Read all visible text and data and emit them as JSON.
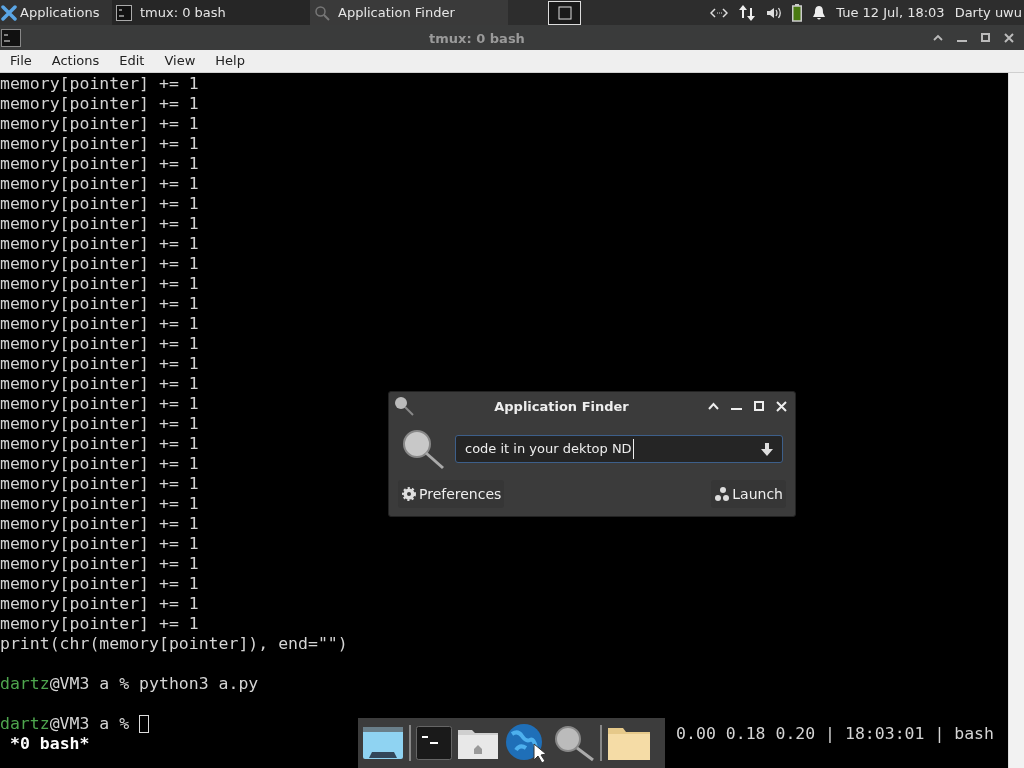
{
  "top_panel": {
    "applications_label": "Applications",
    "tasks": [
      {
        "label": "tmux: 0 bash",
        "kind": "terminal",
        "selected": false
      },
      {
        "label": "Application Finder",
        "kind": "search",
        "selected": true
      }
    ],
    "clock": "Tue 12 Jul, 18:03",
    "user": "Darty uwu"
  },
  "window": {
    "title": "tmux: 0 bash",
    "menu": [
      "File",
      "Actions",
      "Edit",
      "View",
      "Help"
    ]
  },
  "terminal": {
    "lines": [
      {
        "kind": "output",
        "text": "memory[pointer] += 1"
      },
      {
        "kind": "output",
        "text": "memory[pointer] += 1"
      },
      {
        "kind": "output",
        "text": "memory[pointer] += 1"
      },
      {
        "kind": "output",
        "text": "memory[pointer] += 1"
      },
      {
        "kind": "output",
        "text": "memory[pointer] += 1"
      },
      {
        "kind": "output",
        "text": "memory[pointer] += 1"
      },
      {
        "kind": "output",
        "text": "memory[pointer] += 1"
      },
      {
        "kind": "output",
        "text": "memory[pointer] += 1"
      },
      {
        "kind": "output",
        "text": "memory[pointer] += 1"
      },
      {
        "kind": "output",
        "text": "memory[pointer] += 1"
      },
      {
        "kind": "output",
        "text": "memory[pointer] += 1"
      },
      {
        "kind": "output",
        "text": "memory[pointer] += 1"
      },
      {
        "kind": "output",
        "text": "memory[pointer] += 1"
      },
      {
        "kind": "output",
        "text": "memory[pointer] += 1"
      },
      {
        "kind": "output",
        "text": "memory[pointer] += 1"
      },
      {
        "kind": "output",
        "text": "memory[pointer] += 1"
      },
      {
        "kind": "output",
        "text": "memory[pointer] += 1"
      },
      {
        "kind": "output",
        "text": "memory[pointer] += 1"
      },
      {
        "kind": "output",
        "text": "memory[pointer] += 1"
      },
      {
        "kind": "output",
        "text": "memory[pointer] += 1"
      },
      {
        "kind": "output",
        "text": "memory[pointer] += 1"
      },
      {
        "kind": "output",
        "text": "memory[pointer] += 1"
      },
      {
        "kind": "output",
        "text": "memory[pointer] += 1"
      },
      {
        "kind": "output",
        "text": "memory[pointer] += 1"
      },
      {
        "kind": "output",
        "text": "memory[pointer] += 1"
      },
      {
        "kind": "output",
        "text": "memory[pointer] += 1"
      },
      {
        "kind": "output",
        "text": "memory[pointer] += 1"
      },
      {
        "kind": "output",
        "text": "memory[pointer] += 1"
      },
      {
        "kind": "output",
        "text": "print(chr(memory[pointer]), end=\"\")"
      },
      {
        "kind": "blank"
      },
      {
        "kind": "prompt",
        "user": "dartz",
        "rest": "@VM3 a % python3 a.py",
        "cursor": false
      },
      {
        "kind": "blank"
      },
      {
        "kind": "prompt",
        "user": "dartz",
        "rest": "@VM3 a %",
        "cursor": true
      }
    ],
    "status_left": "*0 bash*",
    "status_right": "0.00 0.18 0.20 | 18:03:01 | bash"
  },
  "app_finder": {
    "title": "Application Finder",
    "search_value": "code it in your dektop ND",
    "preferences_label": "Preferences",
    "launch_label": "Launch"
  },
  "dock": {
    "items": [
      {
        "kind": "desktop"
      },
      {
        "kind": "separator"
      },
      {
        "kind": "terminal"
      },
      {
        "kind": "home"
      },
      {
        "kind": "globe"
      },
      {
        "kind": "search"
      },
      {
        "kind": "separator"
      },
      {
        "kind": "folder"
      }
    ]
  }
}
